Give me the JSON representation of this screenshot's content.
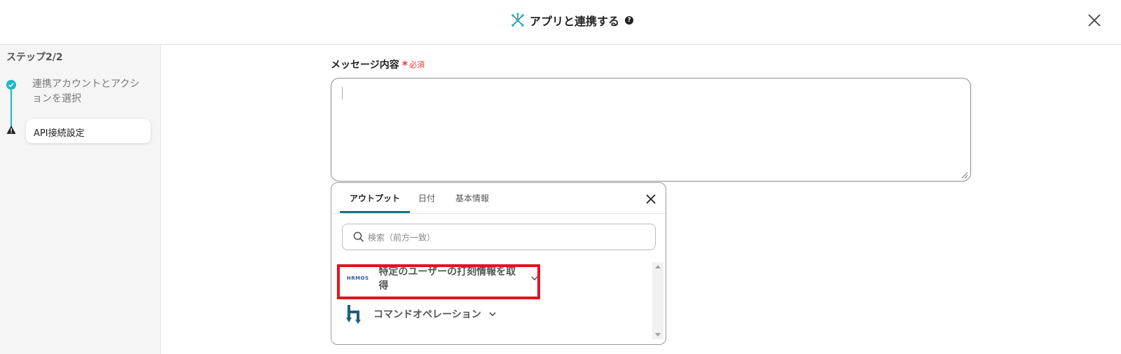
{
  "header": {
    "title": "アプリと連携する",
    "help_icon": "?",
    "icon": "network-icon",
    "close_icon": "close-icon"
  },
  "sidebar": {
    "heading": "ステップ2/2",
    "steps": [
      {
        "label": "連携アカウントとアクションを選択",
        "status": "complete",
        "icon": "check-circle-icon"
      },
      {
        "label": "API接続設定",
        "status": "warning",
        "icon": "warning-icon"
      }
    ],
    "accent_color": "#1bb8c8"
  },
  "form": {
    "label": "メッセージ内容",
    "required_star": "*",
    "required_text": "必須",
    "value": ""
  },
  "panel": {
    "tabs": [
      {
        "label": "アウトプット",
        "active": true
      },
      {
        "label": "日付",
        "active": false
      },
      {
        "label": "基本情報",
        "active": false
      }
    ],
    "search_placeholder": "検索（前方一致）",
    "items": [
      {
        "logo_text": "HRMOS",
        "label": "特定のユーザーの打刻情報を取得",
        "highlighted": true
      },
      {
        "logo_icon": "command-operation-icon",
        "label": "コマンドオペレーション",
        "highlighted": false
      }
    ]
  },
  "colors": {
    "highlight": "#e0141e",
    "tab_underline": "#1f6e80",
    "required": "#e53935"
  }
}
